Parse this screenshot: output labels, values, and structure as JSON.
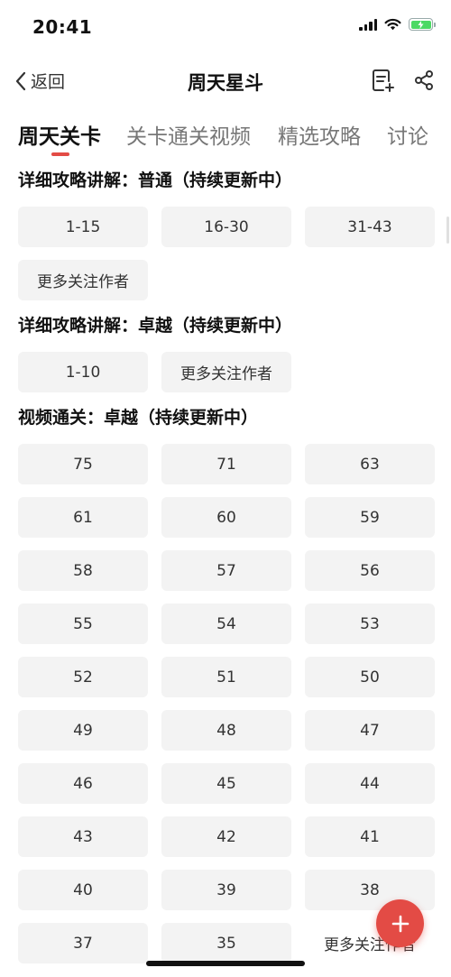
{
  "status_bar": {
    "time": "20:41"
  },
  "nav": {
    "back_label": "返回",
    "title": "周天星斗"
  },
  "tabs": [
    {
      "label": "周天关卡",
      "active": true
    },
    {
      "label": "关卡通关视频",
      "active": false
    },
    {
      "label": "精选攻略",
      "active": false
    },
    {
      "label": "讨论",
      "active": false
    }
  ],
  "sections": [
    {
      "title": "详细攻略讲解：普通（持续更新中）",
      "buttons": [
        "1-15",
        "16-30",
        "31-43",
        "更多关注作者"
      ]
    },
    {
      "title": "详细攻略讲解：卓越（持续更新中）",
      "buttons": [
        "1-10",
        "更多关注作者"
      ]
    },
    {
      "title": "视频通关：卓越（持续更新中）",
      "buttons": [
        "75",
        "71",
        "63",
        "61",
        "60",
        "59",
        "58",
        "57",
        "56",
        "55",
        "54",
        "53",
        "52",
        "51",
        "50",
        "49",
        "48",
        "47",
        "46",
        "45",
        "44",
        "43",
        "42",
        "41",
        "40",
        "39",
        "38",
        "37",
        "35",
        "更多关注作者"
      ]
    }
  ],
  "icons": {
    "back": "chevron-left-icon",
    "nav_action_1": "note-add-icon",
    "nav_action_2": "share-icon",
    "fab": "plus-icon"
  },
  "colors": {
    "accent": "#e34b45",
    "button_bg": "#f3f3f3",
    "battery": "#4cd964"
  }
}
